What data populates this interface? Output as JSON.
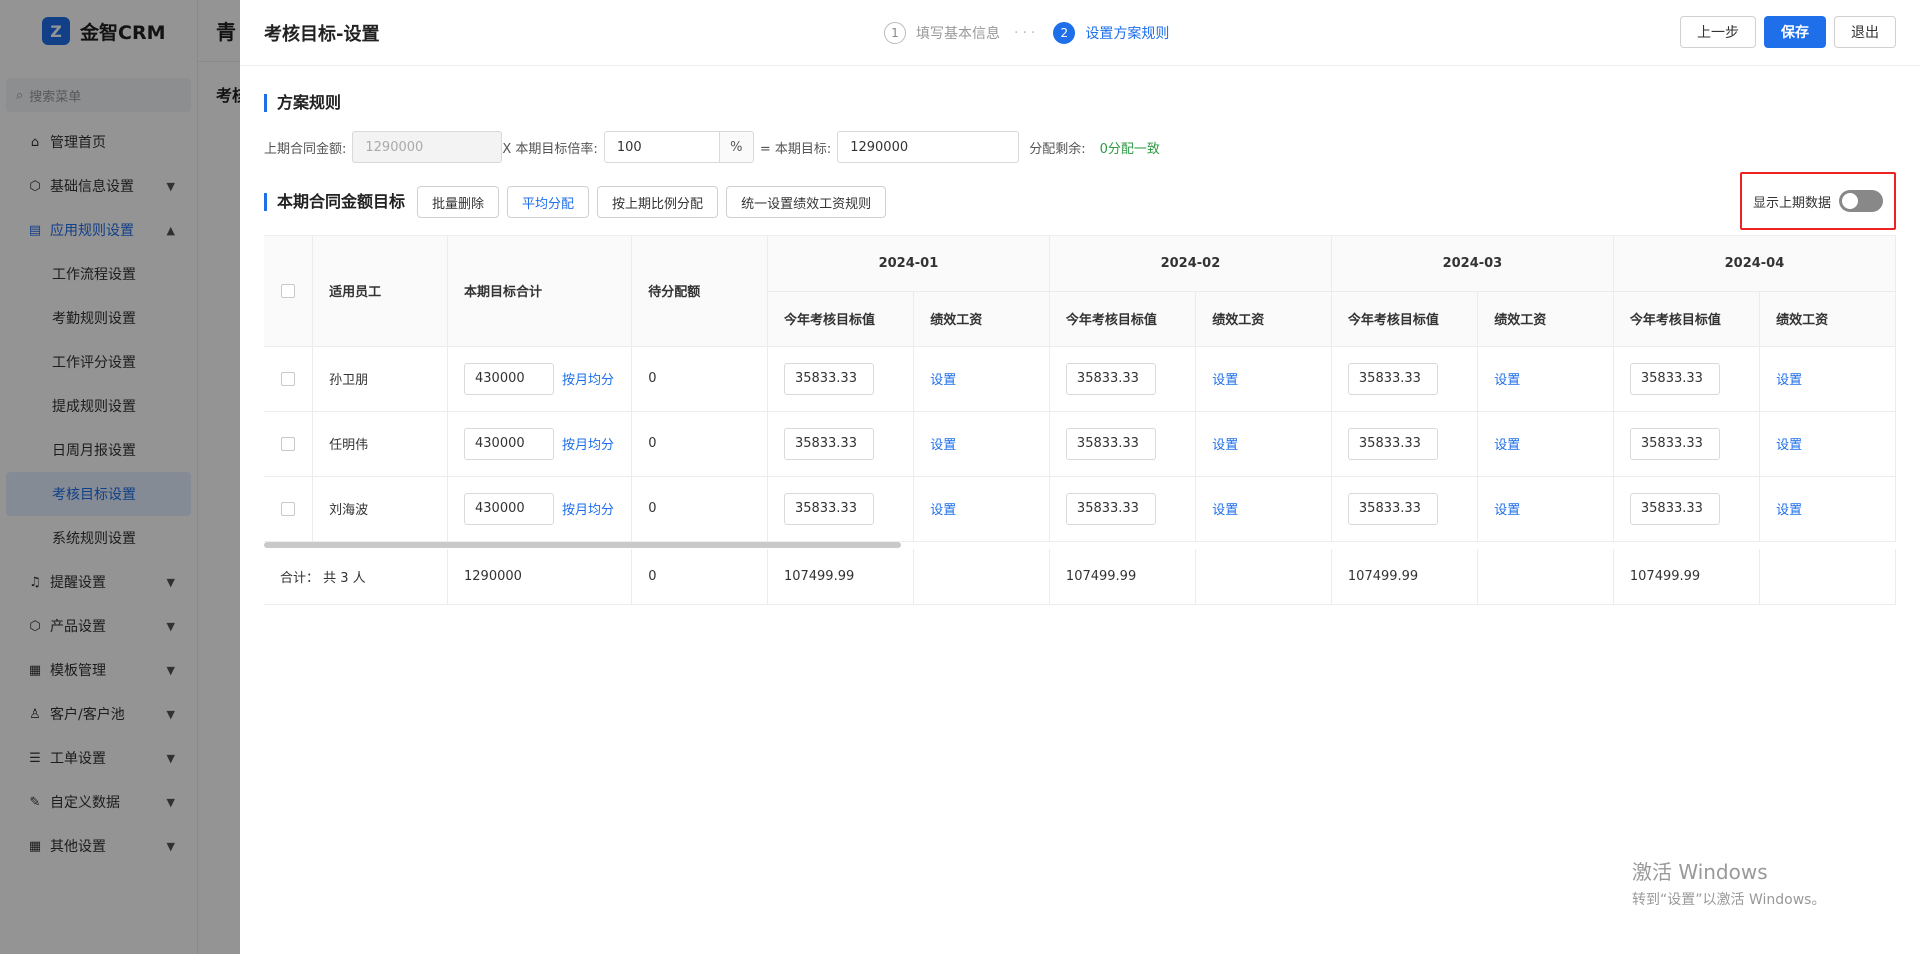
{
  "app": {
    "logo_text": "金智CRM",
    "search_placeholder": "搜索菜单",
    "topbar_crumb": "青",
    "subtitle": "考核",
    "menu": [
      {
        "label": "管理首页",
        "icon": "home-icon"
      },
      {
        "label": "基础信息设置",
        "icon": "cube-icon",
        "chevron": "down"
      },
      {
        "label": "应用规则设置",
        "icon": "doc-icon",
        "chevron": "up",
        "open": true
      }
    ],
    "submenu": [
      "工作流程设置",
      "考勤规则设置",
      "工作评分设置",
      "提成规则设置",
      "日周月报设置",
      "考核目标设置",
      "系统规则设置"
    ],
    "submenu_active": "考核目标设置",
    "menu_rest": [
      {
        "label": "提醒设置",
        "icon": "bell-icon"
      },
      {
        "label": "产品设置",
        "icon": "cube-icon"
      },
      {
        "label": "模板管理",
        "icon": "grid-icon"
      },
      {
        "label": "客户/客户池",
        "icon": "user-icon"
      },
      {
        "label": "工单设置",
        "icon": "list-icon"
      },
      {
        "label": "自定义数据",
        "icon": "tool-icon"
      },
      {
        "label": "其他设置",
        "icon": "grid-icon"
      }
    ]
  },
  "drawer": {
    "title": "考核目标-设置",
    "steps": [
      {
        "num": "1",
        "label": "填写基本信息"
      },
      {
        "num": "2",
        "label": "设置方案规则"
      }
    ],
    "prev_label": "上一步",
    "save_label": "保存",
    "exit_label": "退出"
  },
  "rule": {
    "title": "方案规则",
    "last_amount_label": "上期合同金额:",
    "last_amount_value": "1290000",
    "multiplier_label": "X 本期目标倍率:",
    "multiplier_value": "100",
    "pct": "%",
    "target_label": "= 本期目标:",
    "target_value": "1290000",
    "remain_label": "分配剩余:",
    "remain_value": "0分配一致"
  },
  "target": {
    "title": "本期合同金额目标",
    "batch_delete": "批量删除",
    "avg_distribute": "平均分配",
    "ratio_distribute": "按上期比例分配",
    "unified_rule": "统一设置绩效工资规则",
    "show_last_label": "显示上期数据"
  },
  "table": {
    "headers": {
      "employee": "适用员工",
      "total": "本期目标合计",
      "pending": "待分配额",
      "target_col": "今年考核目标值",
      "salary_col": "绩效工资"
    },
    "months": [
      "2024-01",
      "2024-02",
      "2024-03",
      "2024-04"
    ],
    "rows": [
      {
        "name": "孙卫朋",
        "total": "430000",
        "avg_link": "按月均分",
        "pending": "0",
        "values": [
          "35833.33",
          "35833.33",
          "35833.33",
          "35833.33"
        ],
        "set_link": "设置"
      },
      {
        "name": "任明伟",
        "total": "430000",
        "avg_link": "按月均分",
        "pending": "0",
        "values": [
          "35833.33",
          "35833.33",
          "35833.33",
          "35833.33"
        ],
        "set_link": "设置"
      },
      {
        "name": "刘海波",
        "total": "430000",
        "avg_link": "按月均分",
        "pending": "0",
        "values": [
          "35833.33",
          "35833.33",
          "35833.33",
          "35833.33"
        ],
        "set_link": "设置"
      }
    ],
    "footer": {
      "label": "合计： 共 3 人",
      "total": "1290000",
      "pending": "0",
      "month_totals": [
        "107499.99",
        "107499.99",
        "107499.99",
        "107499.99"
      ]
    }
  },
  "watermark": {
    "line1": "激活 Windows",
    "line2": "转到“设置”以激活 Windows。"
  }
}
